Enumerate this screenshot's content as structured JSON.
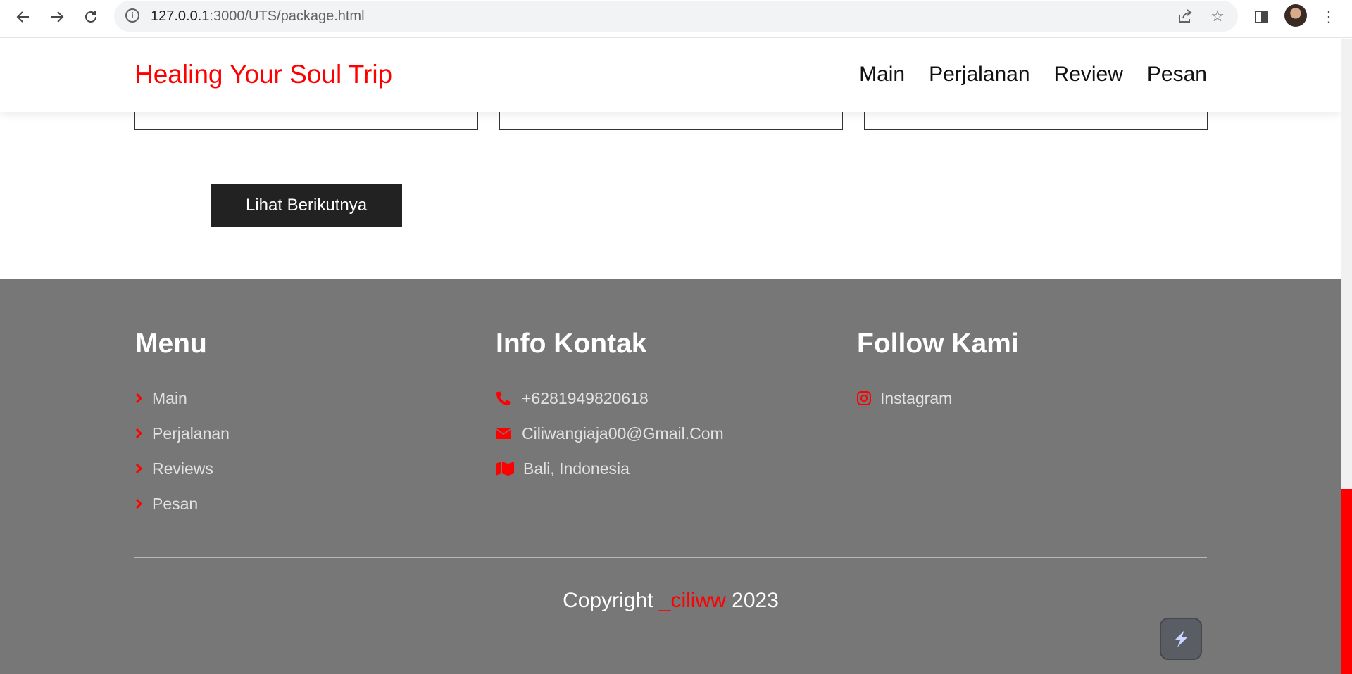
{
  "browser": {
    "url_host": "127.0.0.1",
    "url_path": ":3000/UTS/package.html"
  },
  "site": {
    "logo": "Healing Your Soul Trip",
    "nav": [
      "Main",
      "Perjalanan",
      "Review",
      "Pesan"
    ]
  },
  "content": {
    "more_button": "Lihat Berikutnya"
  },
  "footer": {
    "menu": {
      "title": "Menu",
      "items": [
        "Main",
        "Perjalanan",
        "Reviews",
        "Pesan"
      ]
    },
    "contact": {
      "title": "Info Kontak",
      "phone": "+6281949820618",
      "email": "Ciliwangiaja00@Gmail.Com",
      "location": "Bali, Indonesia"
    },
    "follow": {
      "title": "Follow Kami",
      "instagram": "Instagram"
    },
    "copyright_prefix": "Copyright ",
    "copyright_brand": "_ciliww",
    "copyright_year": " 2023"
  },
  "colors": {
    "accent": "#ff0000",
    "footer_bg": "#777777",
    "button_bg": "#222222"
  },
  "icons": {
    "back": "arrow-left-icon",
    "forward": "arrow-right-icon",
    "reload": "reload-icon",
    "info": "info-icon",
    "share": "share-icon",
    "bookmark": "star-icon",
    "sidebar": "side-panel-icon",
    "menu": "more-vertical-icon",
    "menu_bullet": "chevron-right-icon",
    "phone": "phone-icon",
    "email": "envelope-icon",
    "location": "map-icon",
    "instagram": "instagram-icon"
  }
}
